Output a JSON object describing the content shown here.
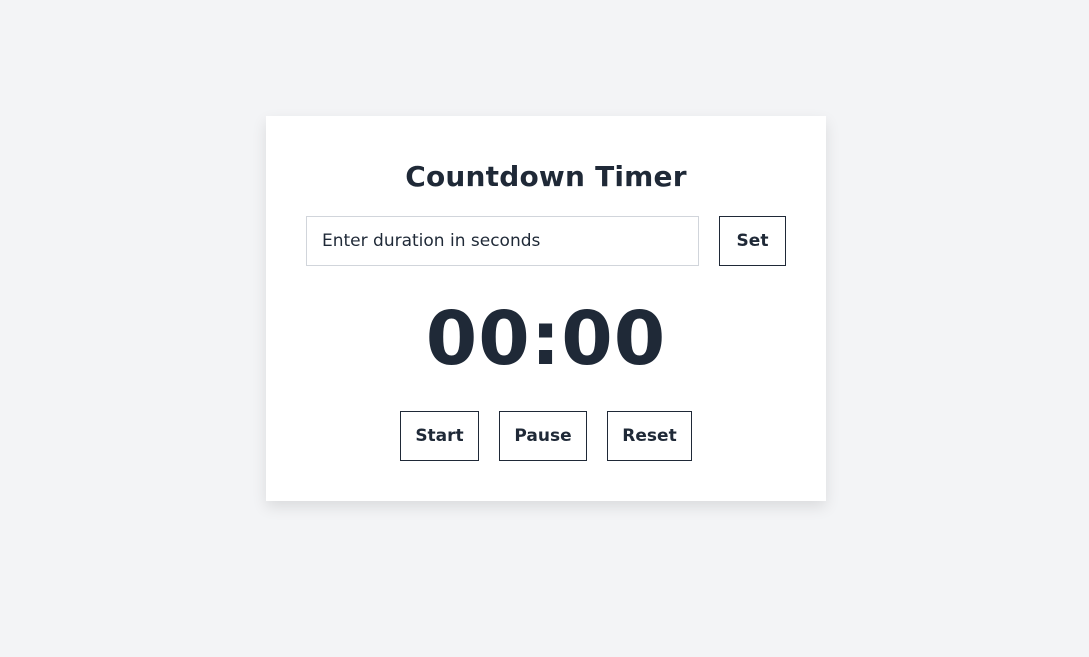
{
  "timer": {
    "title": "Countdown Timer",
    "duration_input": {
      "placeholder": "Enter duration in seconds",
      "value": ""
    },
    "set_label": "Set",
    "display": "00:00",
    "controls": {
      "start_label": "Start",
      "pause_label": "Pause",
      "reset_label": "Reset"
    }
  }
}
